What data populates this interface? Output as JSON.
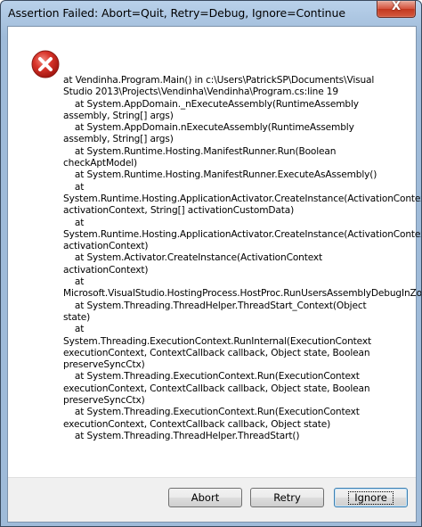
{
  "window": {
    "title": "Assertion Failed: Abort=Quit, Retry=Debug, Ignore=Continue",
    "close_glyph": "X"
  },
  "icon": {
    "name": "error-icon",
    "color": "#c6261f"
  },
  "message": {
    "text": "at Vendinha.Program.Main() in c:\\Users\\PatrickSP\\Documents\\Visual Studio 2013\\Projects\\Vendinha\\Vendinha\\Program.cs:line 19\n    at System.AppDomain._nExecuteAssembly(RuntimeAssembly assembly, String[] args)\n    at System.AppDomain.nExecuteAssembly(RuntimeAssembly assembly, String[] args)\n    at System.Runtime.Hosting.ManifestRunner.Run(Boolean checkAptModel)\n    at System.Runtime.Hosting.ManifestRunner.ExecuteAsAssembly()\n    at System.Runtime.Hosting.ApplicationActivator.CreateInstance(ActivationContext activationContext, String[] activationCustomData)\n    at System.Runtime.Hosting.ApplicationActivator.CreateInstance(ActivationContext activationContext)\n    at System.Activator.CreateInstance(ActivationContext activationContext)\n    at Microsoft.VisualStudio.HostingProcess.HostProc.RunUsersAssemblyDebugInZone()\n    at System.Threading.ThreadHelper.ThreadStart_Context(Object state)\n    at System.Threading.ExecutionContext.RunInternal(ExecutionContext executionContext, ContextCallback callback, Object state, Boolean preserveSyncCtx)\n    at System.Threading.ExecutionContext.Run(ExecutionContext executionContext, ContextCallback callback, Object state, Boolean preserveSyncCtx)\n    at System.Threading.ExecutionContext.Run(ExecutionContext executionContext, ContextCallback callback, Object state)\n    at System.Threading.ThreadHelper.ThreadStart()"
  },
  "buttons": {
    "abort": "Abort",
    "retry": "Retry",
    "ignore": "Ignore"
  }
}
